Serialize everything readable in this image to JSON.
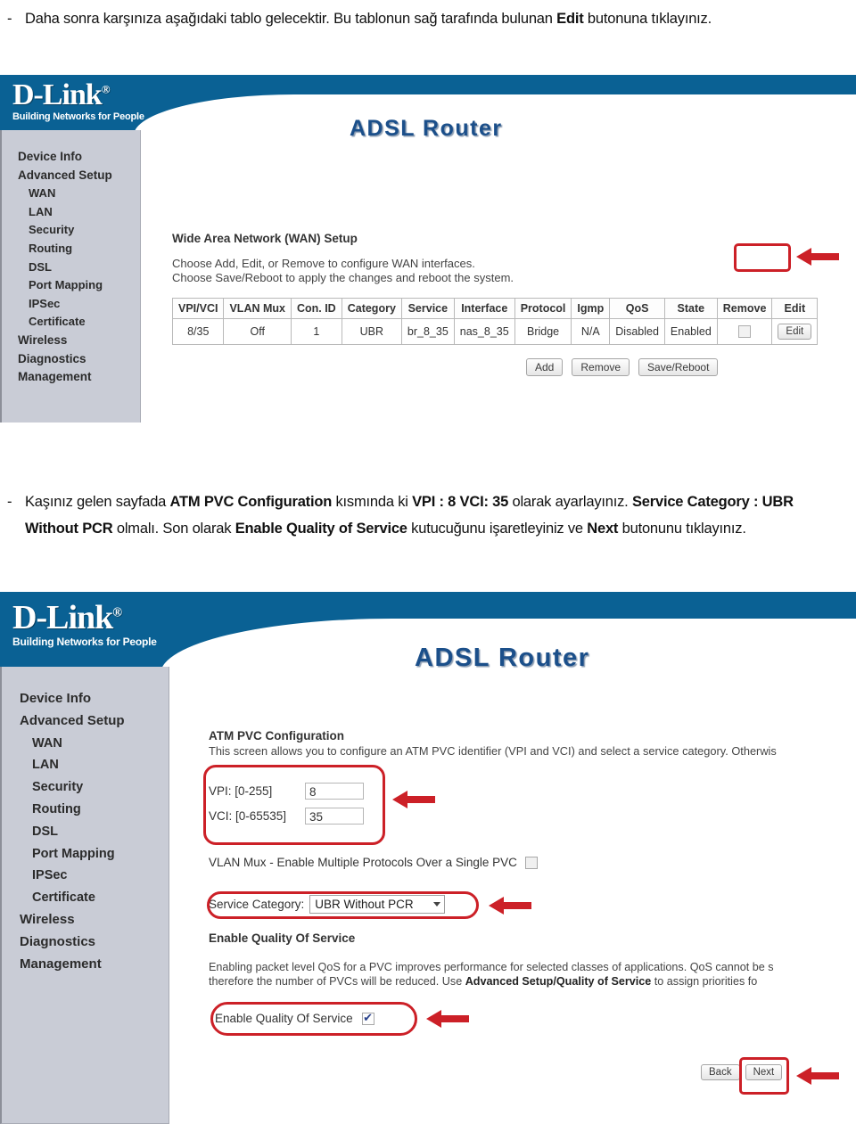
{
  "instructions": [
    {
      "bullet": "-",
      "segments": [
        {
          "text": "Daha sonra karşınıza aşağıdaki tablo gelecektir. Bu tablonun sağ tarafında bulunan ",
          "bold": false
        },
        {
          "text": "Edit",
          "bold": true
        },
        {
          "text": " butonuna tıklayınız.",
          "bold": false
        }
      ]
    },
    {
      "bullet": "-",
      "segments": [
        {
          "text": "Kaşınız gelen sayfada ",
          "bold": false
        },
        {
          "text": "ATM PVC Configuration",
          "bold": true
        },
        {
          "text": " kısmında ki ",
          "bold": false
        },
        {
          "text": "VPI : 8 VCI: 35",
          "bold": true
        },
        {
          "text": " olarak ayarlayınız. ",
          "bold": false
        },
        {
          "text": "Service Category : UBR Without PCR",
          "bold": true
        },
        {
          "text": " olmalı. Son olarak ",
          "bold": false
        },
        {
          "text": "Enable Quality of Service",
          "bold": true
        },
        {
          "text": " kutucuğunu işaretleyiniz ve ",
          "bold": false
        },
        {
          "text": "Next",
          "bold": true
        },
        {
          "text": " butonunu tıklayınız.",
          "bold": false
        }
      ]
    }
  ],
  "brand": {
    "logo_main": "D-Link",
    "logo_registered": "®",
    "tagline": "Building Networks for People",
    "product_title": "ADSL Router",
    "banner_color": "#0a6194",
    "title_color": "#1b4f8a",
    "highlight_color": "#cc2027",
    "sidebar_color": "#c9ccd6"
  },
  "sidebar": {
    "items": [
      {
        "label": "Device Info",
        "sub": false
      },
      {
        "label": "Advanced Setup",
        "sub": false
      },
      {
        "label": "WAN",
        "sub": true
      },
      {
        "label": "LAN",
        "sub": true
      },
      {
        "label": "Security",
        "sub": true
      },
      {
        "label": "Routing",
        "sub": true
      },
      {
        "label": "DSL",
        "sub": true
      },
      {
        "label": "Port Mapping",
        "sub": true
      },
      {
        "label": "IPSec",
        "sub": true
      },
      {
        "label": "Certificate",
        "sub": true
      },
      {
        "label": "Wireless",
        "sub": false
      },
      {
        "label": "Diagnostics",
        "sub": false
      },
      {
        "label": "Management",
        "sub": false
      }
    ]
  },
  "wan_page": {
    "heading": "Wide Area Network (WAN) Setup",
    "desc_line1": "Choose Add, Edit, or Remove to configure WAN interfaces.",
    "desc_line2": "Choose Save/Reboot to apply the changes and reboot the system.",
    "table": {
      "headers": [
        "VPI/VCI",
        "VLAN Mux",
        "Con. ID",
        "Category",
        "Service",
        "Interface",
        "Protocol",
        "Igmp",
        "QoS",
        "State",
        "Remove",
        "Edit"
      ],
      "rows": [
        {
          "vpi_vci": "8/35",
          "vlan_mux": "Off",
          "con_id": "1",
          "category": "UBR",
          "service": "br_8_35",
          "interface": "nas_8_35",
          "protocol": "Bridge",
          "igmp": "N/A",
          "qos": "Disabled",
          "state": "Enabled",
          "remove_checked": false,
          "edit_label": "Edit"
        }
      ]
    },
    "buttons": {
      "add": "Add",
      "remove": "Remove",
      "save_reboot": "Save/Reboot"
    }
  },
  "pvc_page": {
    "heading": "ATM PVC Configuration",
    "description": "This screen allows you to configure an ATM PVC identifier (VPI and VCI) and select a service category. Otherwis",
    "vpi": {
      "label": "VPI: [0-255]",
      "value": "8"
    },
    "vci": {
      "label": "VCI: [0-65535]",
      "value": "35"
    },
    "vlan_mux": {
      "label": "VLAN Mux - Enable Multiple Protocols Over a Single PVC",
      "checked": false
    },
    "service_category": {
      "label": "Service Category:",
      "value": "UBR Without PCR"
    },
    "qos_heading": "Enable Quality Of Service",
    "qos_desc_line1": "Enabling packet level QoS for a PVC improves performance for selected classes of applications.  QoS cannot be s",
    "qos_desc_line2_a": "therefore the number of PVCs will be reduced. Use ",
    "qos_desc_line2_b": "Advanced Setup/Quality of Service",
    "qos_desc_line2_c": " to assign priorities fo",
    "qos_checkbox": {
      "label": "Enable Quality Of Service",
      "checked": true
    },
    "buttons": {
      "back": "Back",
      "next": "Next"
    }
  }
}
